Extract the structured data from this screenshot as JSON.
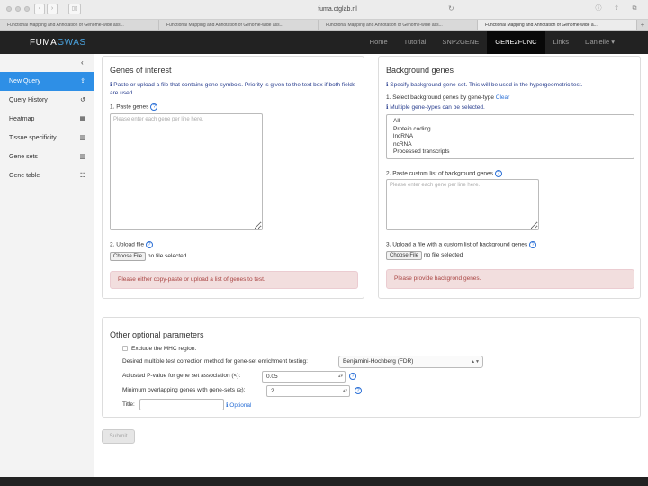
{
  "browser": {
    "url": "fuma.ctglab.nl",
    "tabs": [
      "Functional Mapping and Annotation of Genome-wide ass...",
      "Functional Mapping and Annotation of Genome-wide ass...",
      "Functional Mapping and Annotation of Genome-wide ass...",
      "Functional Mapping and Annotation of Genome-wide a..."
    ]
  },
  "navbar": {
    "logo_main": "FUMA",
    "logo_accent": "GWAS",
    "items": [
      "Home",
      "Tutorial",
      "SNP2GENE",
      "GENE2FUNC",
      "Links",
      "Danielle ▾"
    ],
    "active": "GENE2FUNC"
  },
  "sidebar": {
    "collapse_icon": "‹",
    "items": [
      {
        "label": "New Query",
        "icon": "⇪"
      },
      {
        "label": "Query History",
        "icon": "↺"
      },
      {
        "label": "Heatmap",
        "icon": "▦"
      },
      {
        "label": "Tissue specificity",
        "icon": "▥"
      },
      {
        "label": "Gene sets",
        "icon": "▥"
      },
      {
        "label": "Gene table",
        "icon": "☷"
      }
    ]
  },
  "genes_panel": {
    "title": "Genes of interest",
    "info": "ℹ Paste or upload a file that contains gene-symbols. Priority is given to the text box if both fields are used.",
    "paste_label": "1. Paste genes",
    "paste_placeholder": "Please enter each gene per line here.",
    "upload_label": "2. Upload file",
    "choose_file": "Choose File",
    "no_file": "no file selected",
    "alert": "Please either copy-paste or upload a list of genes to test."
  },
  "background_panel": {
    "title": "Background genes",
    "info": "ℹ Specify background gene-set. This will be used in the hypergeometric test.",
    "select_label": "1. Select background genes by gene-type",
    "clear": "Clear",
    "multi_info": "ℹ Multiple gene-types can be selected.",
    "gene_types": [
      "All",
      "Protein coding",
      "lncRNA",
      "ncRNA",
      "Processed transcripts"
    ],
    "paste_label": "2. Paste custom list of background genes",
    "paste_placeholder": "Please enter each gene per line here.",
    "upload_label": "3. Upload a file with a custom list of background genes",
    "choose_file": "Choose File",
    "no_file": "no file selected",
    "alert": "Please provide backgrond genes."
  },
  "optional": {
    "title": "Other optional parameters",
    "mhc_label": "Exclude the MHC region.",
    "correction_label": "Desired multiple test correction method for gene-set enrichment testing:",
    "correction_value": "Benjamini-Hochberg (FDR)",
    "pvalue_label": "Adjusted P-value for gene set association (<):",
    "pvalue_value": "0.05",
    "overlap_label": "Minimum overlapping genes with gene-sets (≥):",
    "overlap_value": "2",
    "title_label": "Title:",
    "title_hint": "ℹ Optional"
  },
  "submit_label": "Submit"
}
